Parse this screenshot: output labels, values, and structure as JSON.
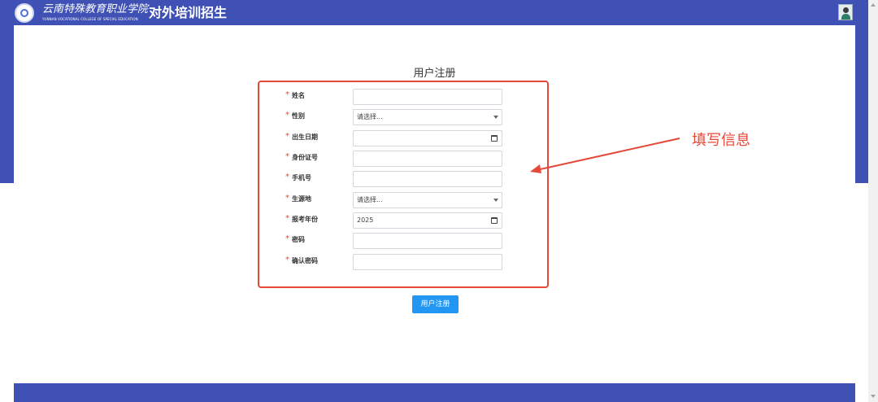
{
  "header": {
    "school_name_cn": "云南特殊教育职业学院",
    "school_name_en": "YUNNAN VOCATIONAL COLLEGE OF SPECIAL EDUCATION",
    "app_title": "对外培训招生",
    "logo_icon": "school-emblem-icon",
    "avatar_icon": "user-avatar-icon"
  },
  "form": {
    "title": "用户注册",
    "required_mark": "*",
    "fields": [
      {
        "label": "姓名",
        "type": "text",
        "value": ""
      },
      {
        "label": "性别",
        "type": "select",
        "value": "请选择..."
      },
      {
        "label": "出生日期",
        "type": "date",
        "value": ""
      },
      {
        "label": "身份证号",
        "type": "text",
        "value": ""
      },
      {
        "label": "手机号",
        "type": "text",
        "value": ""
      },
      {
        "label": "生源地",
        "type": "select",
        "value": "请选择..."
      },
      {
        "label": "报考年份",
        "type": "date",
        "value": "2025"
      },
      {
        "label": "密码",
        "type": "password",
        "value": ""
      },
      {
        "label": "确认密码",
        "type": "password",
        "value": ""
      }
    ],
    "submit_label": "用户注册"
  },
  "annotation": {
    "text": "填写信息",
    "color": "#e5493a"
  },
  "colors": {
    "brand": "#3f51b5",
    "button": "#2196f3",
    "required": "#e5493a"
  }
}
